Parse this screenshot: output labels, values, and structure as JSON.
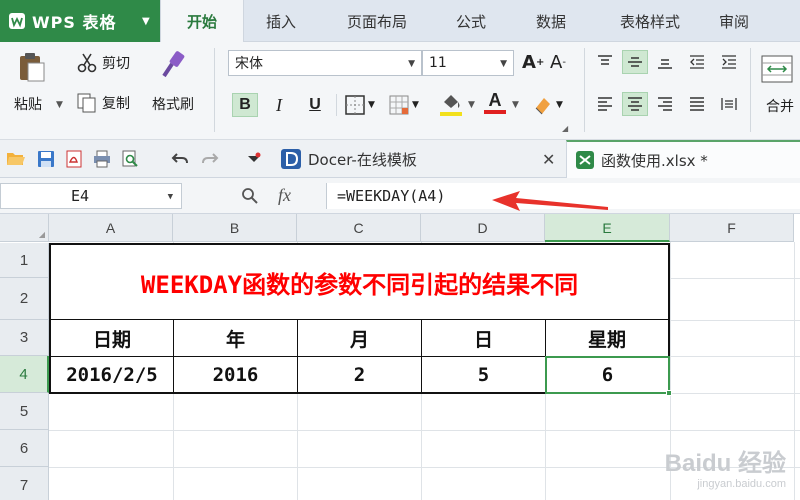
{
  "app": {
    "name": "WPS 表格"
  },
  "ribbon_tabs": [
    "开始",
    "插入",
    "页面布局",
    "公式",
    "数据",
    "表格样式",
    "审阅"
  ],
  "active_tab_index": 0,
  "clipboard": {
    "paste": "粘贴",
    "cut": "剪切",
    "copy": "复制",
    "format_painter": "格式刷"
  },
  "font": {
    "name": "宋体",
    "size": "11"
  },
  "format_buttons": {
    "bold": "B",
    "italic": "I",
    "underline": "U"
  },
  "font_color": "#e02020",
  "highlight_color": "#f2e01c",
  "merge_label": "合并",
  "doc_tabs": {
    "docer": "Docer-在线模板",
    "file": "函数使用.xlsx *"
  },
  "formula_bar": {
    "name_box": "E4",
    "fx": "fx",
    "formula": "=WEEKDAY(A4)"
  },
  "columns": [
    "A",
    "B",
    "C",
    "D",
    "E",
    "F"
  ],
  "rows": [
    "1",
    "2",
    "3",
    "4",
    "5",
    "6",
    "7"
  ],
  "selected_column": "E",
  "selected_row": "4",
  "sheet": {
    "title": "WEEKDAY函数的参数不同引起的结果不同",
    "headers": [
      "日期",
      "年",
      "月",
      "日",
      "星期"
    ],
    "values": [
      "2016/2/5",
      "2016",
      "2",
      "5",
      "6"
    ]
  },
  "watermark": {
    "brand": "Baidu 经验",
    "url": "jingyan.baidu.com"
  }
}
